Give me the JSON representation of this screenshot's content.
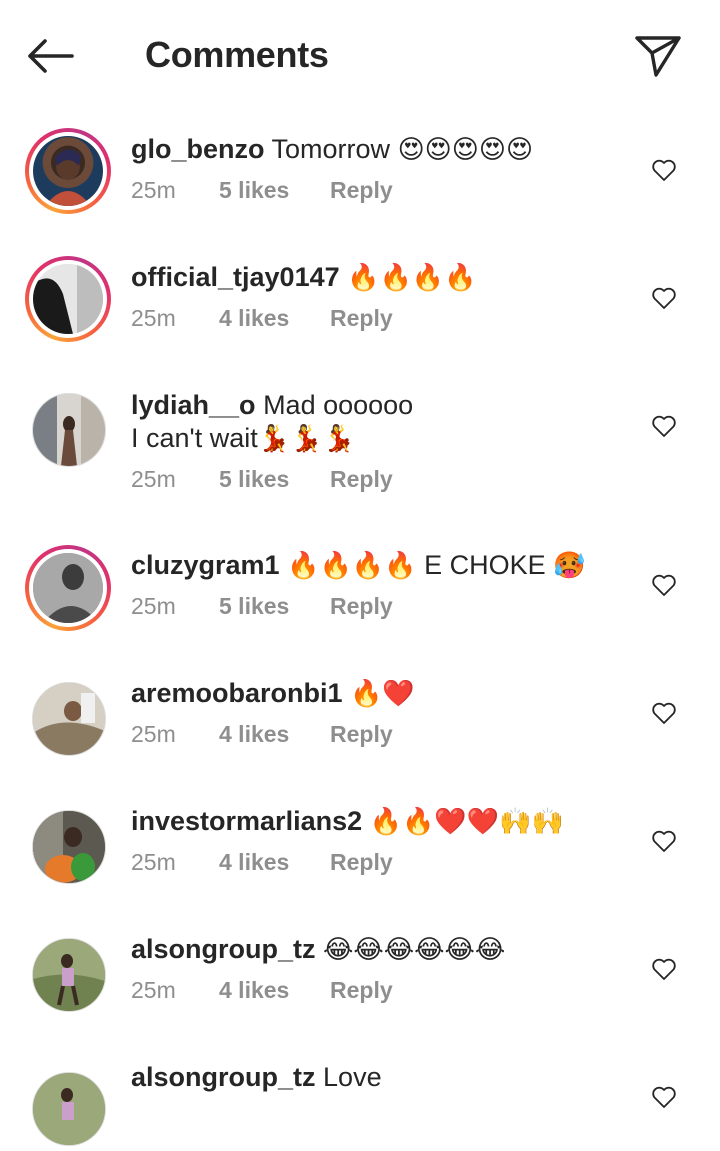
{
  "header": {
    "title": "Comments"
  },
  "comments": [
    {
      "username": "glo_benzo",
      "text": "Tomorrow",
      "emoji": "😍😍😍😍😍",
      "time": "25m",
      "likes": "5 likes",
      "reply": "Reply",
      "story_ring": true
    },
    {
      "username": "official_tjay0147",
      "text": "",
      "emoji": "🔥🔥🔥🔥",
      "time": "25m",
      "likes": "4 likes",
      "reply": "Reply",
      "story_ring": true
    },
    {
      "username": "lydiah__o",
      "text": "Mad oooooo",
      "line2": "I can't wait",
      "line2_emoji": "💃💃💃",
      "time": "25m",
      "likes": "5 likes",
      "reply": "Reply",
      "story_ring": false
    },
    {
      "username": "cluzygram1",
      "text": "",
      "emoji": "🔥🔥🔥🔥",
      "text_after": "E CHOKE",
      "emoji_after": "🥵",
      "time": "25m",
      "likes": "5 likes",
      "reply": "Reply",
      "story_ring": true
    },
    {
      "username": "aremoobaronbi1",
      "text": "",
      "emoji": "🔥❤️",
      "time": "25m",
      "likes": "4 likes",
      "reply": "Reply",
      "story_ring": false
    },
    {
      "username": "investormarlians2",
      "text": "",
      "emoji": "🔥🔥❤️❤️🙌🙌",
      "time": "25m",
      "likes": "4 likes",
      "reply": "Reply",
      "story_ring": false
    },
    {
      "username": "alsongroup_tz",
      "text": "",
      "emoji": "😂😂😂😂😂😂",
      "time": "25m",
      "likes": "4 likes",
      "reply": "Reply",
      "story_ring": false
    },
    {
      "username": "alsongroup_tz",
      "text": "Love",
      "story_ring": false
    }
  ],
  "icons": {
    "back": "arrow-left-icon",
    "send": "paper-plane-icon",
    "like": "heart-outline-icon"
  },
  "colors": {
    "text": "#262626",
    "meta": "#8e8e8e",
    "ring_start": "#f9a33a",
    "ring_end": "#c13584"
  }
}
